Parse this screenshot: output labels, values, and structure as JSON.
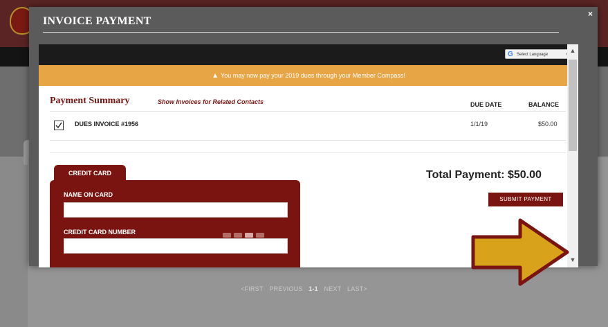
{
  "background": {
    "pager": {
      "first": "<FIRST",
      "previous": "PREVIOUS",
      "current": "1-1",
      "next": "NEXT",
      "last": "LAST>"
    }
  },
  "modal": {
    "title": "INVOICE PAYMENT",
    "close_icon": "×"
  },
  "translate": {
    "label": "Select Language",
    "arrow": "▼"
  },
  "banner": {
    "icon": "▲",
    "text": "You may now pay your 2019 dues through your Member Compass!"
  },
  "summary": {
    "title": "Payment Summary",
    "related_link": "Show Invoices for Related Contacts",
    "columns": {
      "due_date": "DUE DATE",
      "balance": "BALANCE"
    },
    "invoices": [
      {
        "name": "DUES INVOICE #1956",
        "due_date": "1/1/19",
        "balance": "$50.00",
        "checked": true
      }
    ]
  },
  "payment": {
    "tab_label": "CREDIT CARD",
    "name_label": "NAME ON CARD",
    "number_label": "CREDIT CARD NUMBER",
    "total": "Total Payment:  $50.00",
    "submit_label": "SUBMIT PAYMENT"
  },
  "scroll": {
    "up": "▲",
    "down": "▼"
  },
  "colors": {
    "accent": "#7a1410",
    "banner": "#e8a545",
    "arrow_fill": "#d9a21b",
    "arrow_stroke": "#7a1410"
  }
}
